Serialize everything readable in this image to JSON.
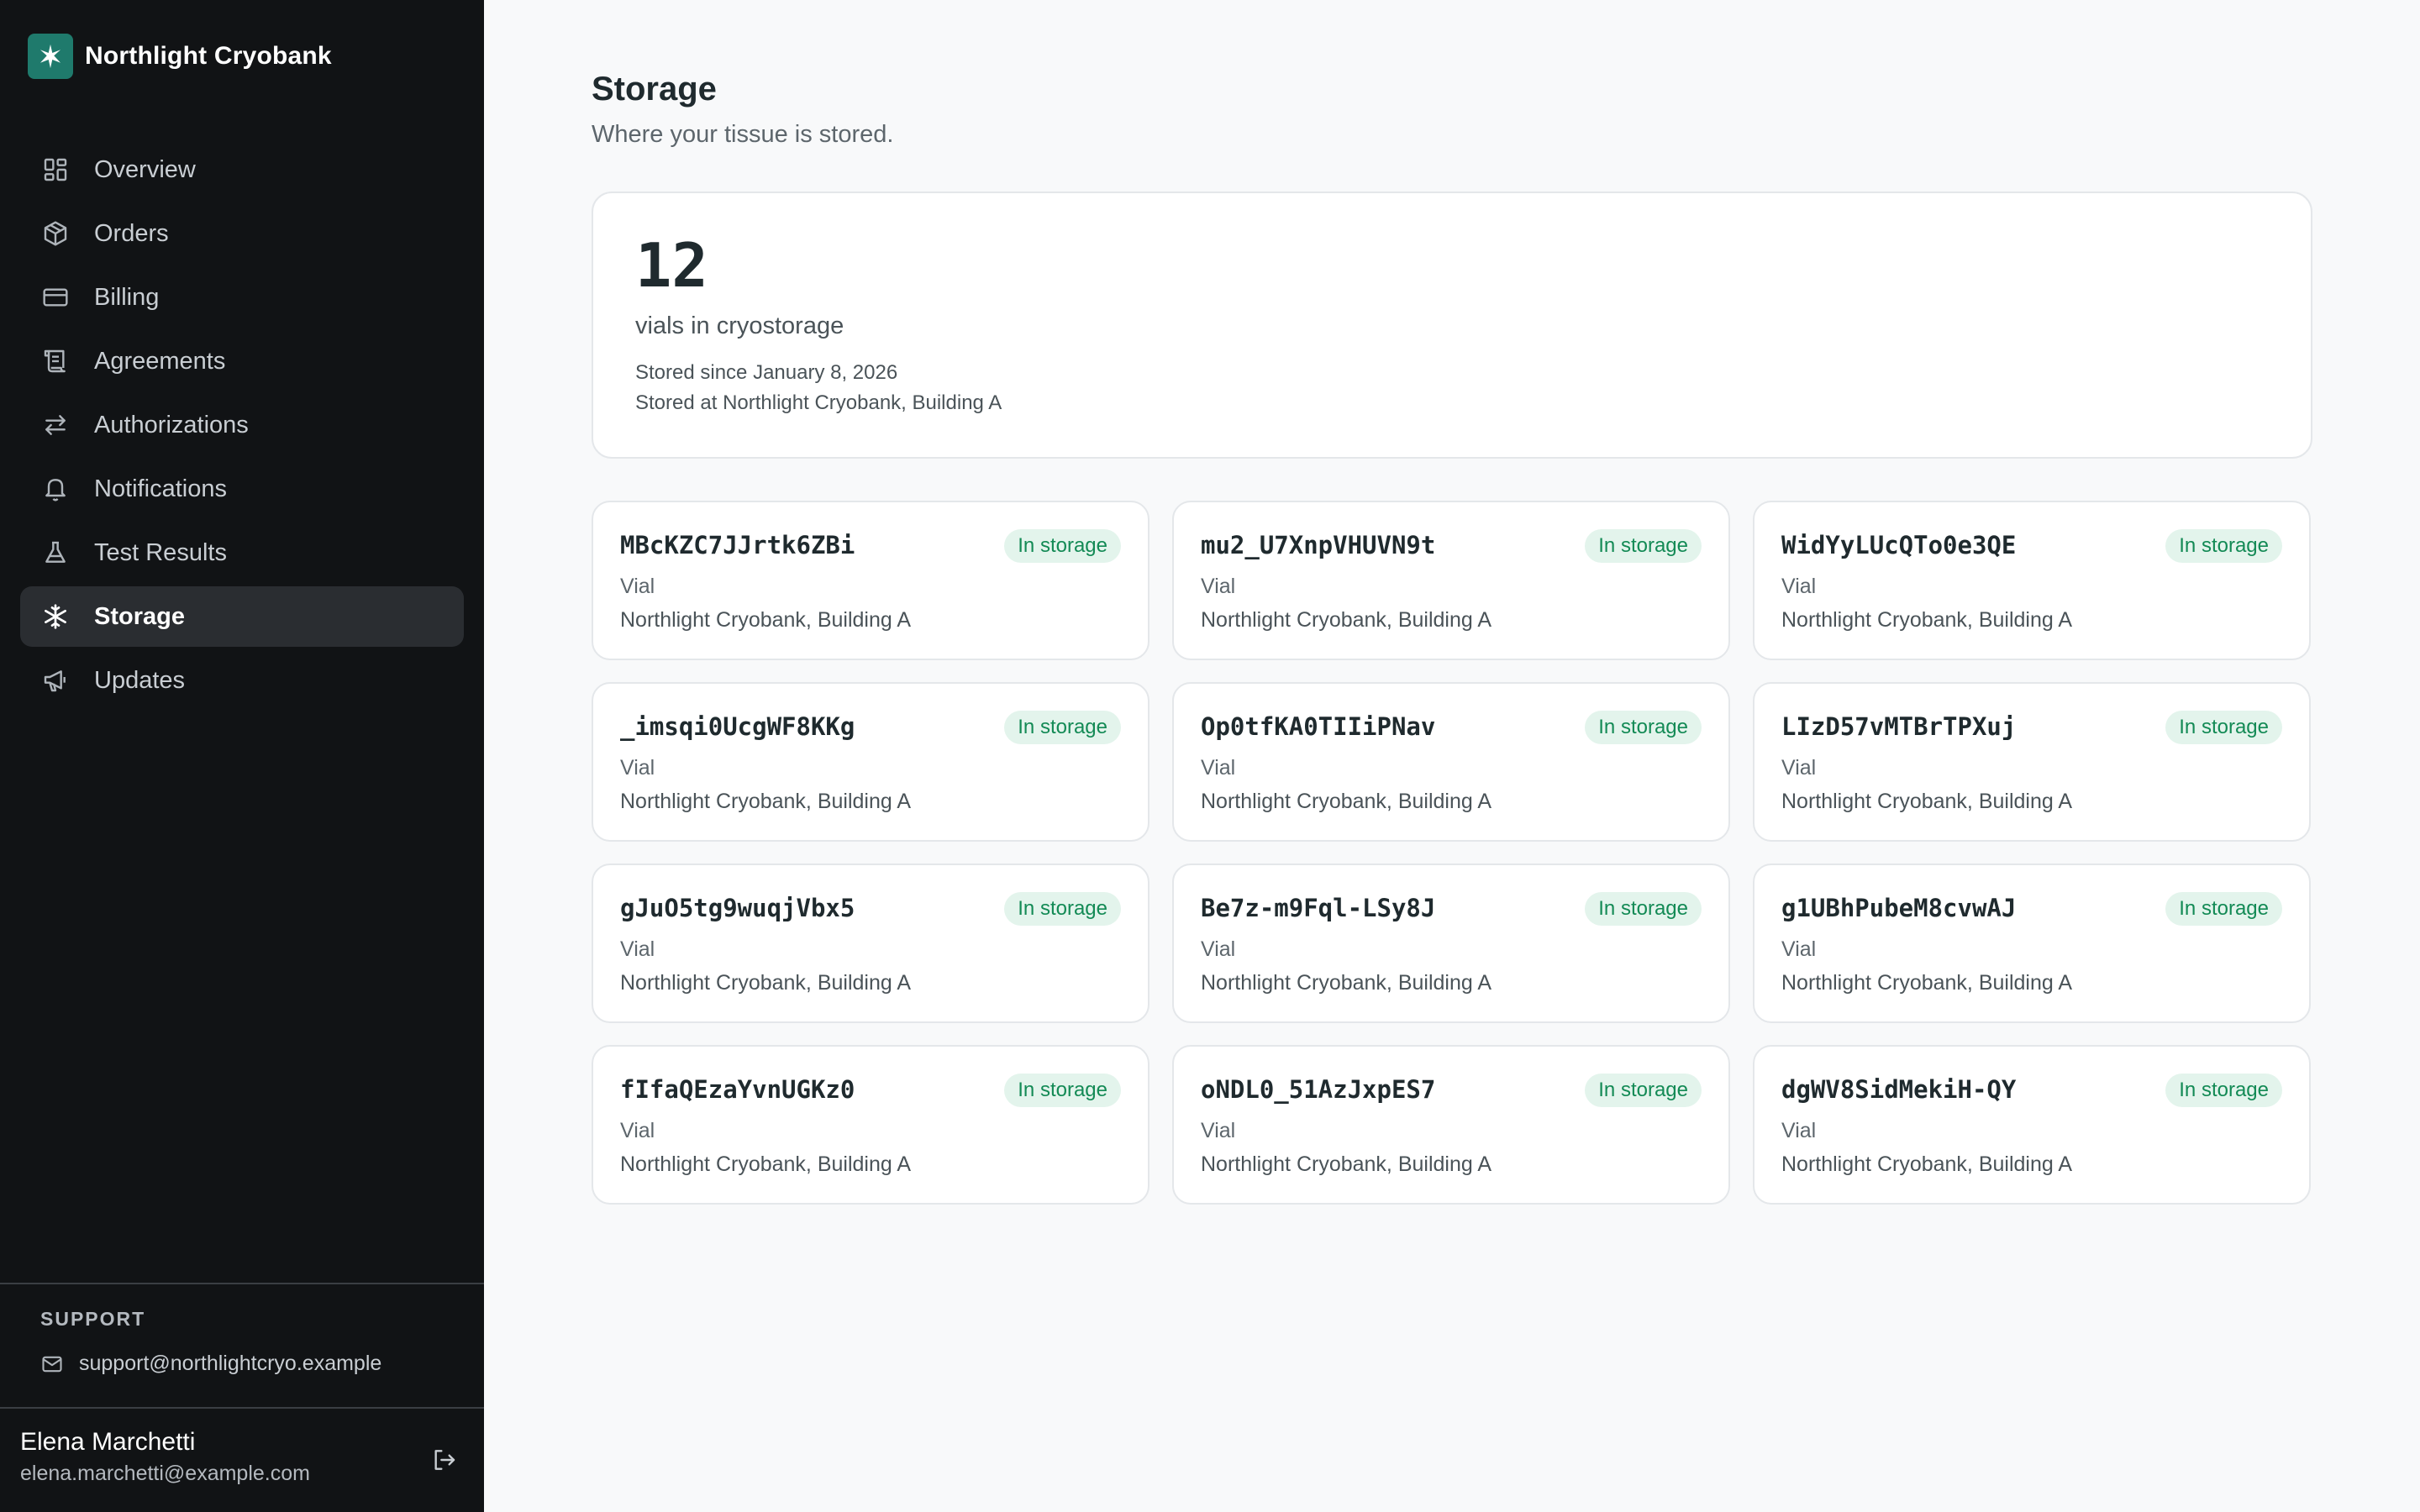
{
  "brand": {
    "name": "Northlight Cryobank",
    "accent": "#1f7a6c"
  },
  "sidebar": {
    "items": [
      {
        "label": "Overview",
        "icon": "grid-icon",
        "active": false
      },
      {
        "label": "Orders",
        "icon": "package-icon",
        "active": false
      },
      {
        "label": "Billing",
        "icon": "credit-card-icon",
        "active": false
      },
      {
        "label": "Agreements",
        "icon": "scroll-icon",
        "active": false
      },
      {
        "label": "Authorizations",
        "icon": "arrows-swap-icon",
        "active": false
      },
      {
        "label": "Notifications",
        "icon": "bell-icon",
        "active": false
      },
      {
        "label": "Test Results",
        "icon": "flask-icon",
        "active": false
      },
      {
        "label": "Storage",
        "icon": "snowflake-icon",
        "active": true
      },
      {
        "label": "Updates",
        "icon": "megaphone-icon",
        "active": false
      }
    ],
    "support": {
      "heading": "SUPPORT",
      "email": "support@northlightcryo.example"
    },
    "user": {
      "name": "Elena Marchetti",
      "email": "elena.marchetti@example.com"
    }
  },
  "main": {
    "title": "Storage",
    "subtitle": "Where your tissue is stored.",
    "summary": {
      "count": "12",
      "label": "vials in cryostorage",
      "since": "Stored since January 8, 2026",
      "location": "Stored at Northlight Cryobank, Building A"
    },
    "vials": [
      {
        "id": "MBcKZC7JJrtk6ZBi",
        "status": "In storage",
        "type": "Vial",
        "location": "Northlight Cryobank, Building A"
      },
      {
        "id": "mu2_U7XnpVHUVN9t",
        "status": "In storage",
        "type": "Vial",
        "location": "Northlight Cryobank, Building A"
      },
      {
        "id": "WidYyLUcQTo0e3QE",
        "status": "In storage",
        "type": "Vial",
        "location": "Northlight Cryobank, Building A"
      },
      {
        "id": "_imsqi0UcgWF8KKg",
        "status": "In storage",
        "type": "Vial",
        "location": "Northlight Cryobank, Building A"
      },
      {
        "id": "Op0tfKA0TIIiPNav",
        "status": "In storage",
        "type": "Vial",
        "location": "Northlight Cryobank, Building A"
      },
      {
        "id": "LIzD57vMTBrTPXuj",
        "status": "In storage",
        "type": "Vial",
        "location": "Northlight Cryobank, Building A"
      },
      {
        "id": "gJuO5tg9wuqjVbx5",
        "status": "In storage",
        "type": "Vial",
        "location": "Northlight Cryobank, Building A"
      },
      {
        "id": "Be7z-m9Fql-LSy8J",
        "status": "In storage",
        "type": "Vial",
        "location": "Northlight Cryobank, Building A"
      },
      {
        "id": "g1UBhPubeM8cvwAJ",
        "status": "In storage",
        "type": "Vial",
        "location": "Northlight Cryobank, Building A"
      },
      {
        "id": "fIfaQEzaYvnUGKz0",
        "status": "In storage",
        "type": "Vial",
        "location": "Northlight Cryobank, Building A"
      },
      {
        "id": "oNDL0_51AzJxpES7",
        "status": "In storage",
        "type": "Vial",
        "location": "Northlight Cryobank, Building A"
      },
      {
        "id": "dgWV8SidMekiH-QY",
        "status": "In storage",
        "type": "Vial",
        "location": "Northlight Cryobank, Building A"
      }
    ]
  }
}
